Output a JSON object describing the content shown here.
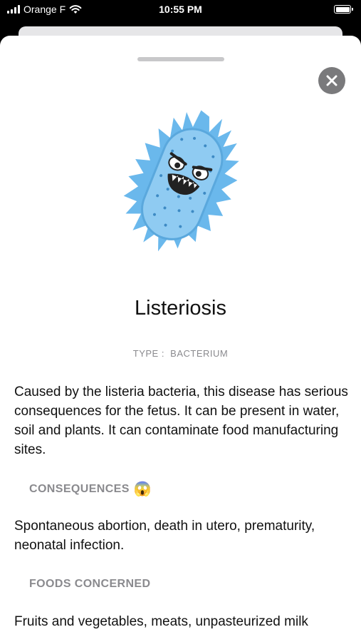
{
  "status_bar": {
    "carrier": "Orange F",
    "time": "10:55 PM"
  },
  "icons": {
    "close": "close-icon",
    "wifi": "wifi-icon",
    "battery": "battery-icon",
    "signal": "cellular-signal-icon",
    "illustration": "bacterium-illustration",
    "emoji": "screaming-face-emoji"
  },
  "colors": {
    "bacterium_body": "#6ab8ec",
    "close_button": "#7a7a7c",
    "muted_text": "#8a8a8e"
  },
  "disease": {
    "title": "Listeriosis",
    "type_label": "TYPE :",
    "type_value": "BACTERIUM",
    "description": "Caused by the listeria bacteria, this disease has serious consequences for the fetus. It can be present in water, soil and plants. It can contaminate food manufacturing sites.",
    "consequences_heading": "CONSEQUENCES",
    "consequences_emoji": "😱",
    "consequences_text": "Spontaneous abortion, death in utero, prematurity, neonatal infection.",
    "foods_heading": "FOODS CONCERNED",
    "foods_text": "Fruits and vegetables, meats, unpasteurized milk"
  }
}
